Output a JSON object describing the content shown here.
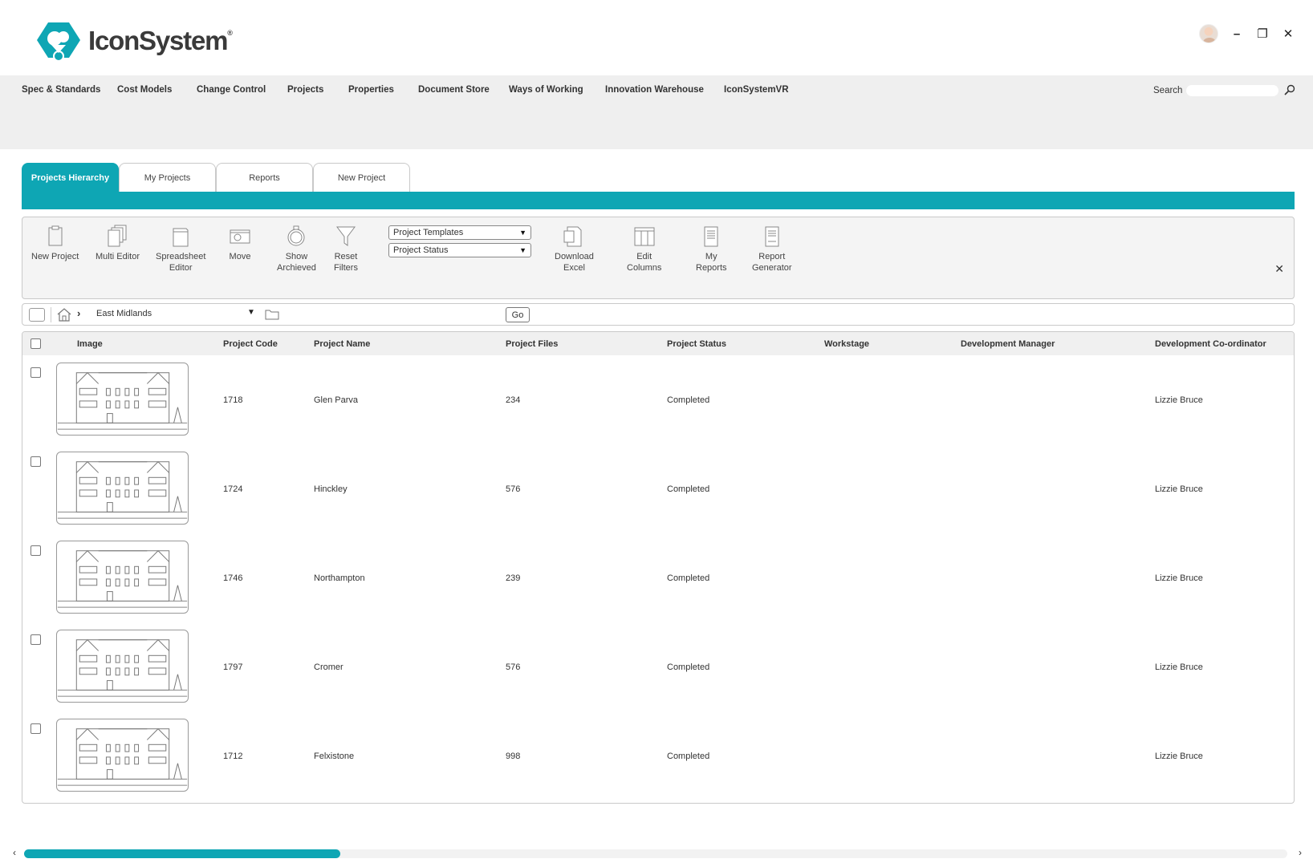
{
  "app": {
    "logo_text": "IconSystem",
    "logo_reg": "®"
  },
  "window": {
    "minimize": "–",
    "restore": "❐",
    "close": "✕"
  },
  "nav": {
    "items": [
      "Spec & Standards",
      "Cost Models",
      "Change Control",
      "Projects",
      "Properties",
      "Document Store",
      "Ways of Working",
      "Innovation Warehouse",
      "IconSystemVR"
    ],
    "search_label": "Search",
    "search_value": ""
  },
  "tabs": [
    "Projects Hierarchy",
    "My Projects",
    "Reports",
    "New Project"
  ],
  "active_tab": "Projects Hierarchy",
  "toolbar": {
    "tools": [
      {
        "label": "New Project",
        "icon": "clipboard-icon"
      },
      {
        "label": "Multi Editor",
        "icon": "multi-document-icon"
      },
      {
        "label": "Spreadsheet\nEditor",
        "icon": "spreadsheet-icon"
      },
      {
        "label": "Move",
        "icon": "move-icon"
      },
      {
        "label": "Show\nArchieved",
        "icon": "archive-icon"
      },
      {
        "label": "Reset\nFilters",
        "icon": "filter-icon"
      },
      {
        "label": "Download\nExcel",
        "icon": "download-excel-icon"
      },
      {
        "label": "Edit\nColumns",
        "icon": "columns-icon"
      },
      {
        "label": "My\nReports",
        "icon": "report-icon"
      },
      {
        "label": "Report\nGenerator",
        "icon": "report-generator-icon"
      }
    ],
    "select_templates": "Project Templates",
    "select_status": "Project Status",
    "close": "✕"
  },
  "breadcrumb": {
    "location": "East Midlands",
    "go_label": "Go"
  },
  "table": {
    "columns": [
      "Image",
      "Project Code",
      "Project Name",
      "Project Files",
      "Project Status",
      "Workstage",
      "Development Manager",
      "Development Co-ordinator"
    ],
    "rows": [
      {
        "code": "1718",
        "name": "Glen Parva",
        "files": "234",
        "status": "Completed",
        "workstage": "",
        "manager": "",
        "coordinator": "Lizzie Bruce"
      },
      {
        "code": "1724",
        "name": "Hinckley",
        "files": "576",
        "status": "Completed",
        "workstage": "",
        "manager": "",
        "coordinator": "Lizzie Bruce"
      },
      {
        "code": "1746",
        "name": "Northampton",
        "files": "239",
        "status": "Completed",
        "workstage": "",
        "manager": "",
        "coordinator": "Lizzie Bruce"
      },
      {
        "code": "1797",
        "name": "Cromer",
        "files": "576",
        "status": "Completed",
        "workstage": "",
        "manager": "",
        "coordinator": "Lizzie Bruce"
      },
      {
        "code": "1712",
        "name": "Felxistone",
        "files": "998",
        "status": "Completed",
        "workstage": "",
        "manager": "",
        "coordinator": "Lizzie Bruce"
      }
    ]
  },
  "scrollbar": {
    "position_fraction": 0.25
  },
  "colors": {
    "accent": "#0ea6b4",
    "nav_bg": "#efefef",
    "toolbar_bg": "#f4f4f4"
  }
}
